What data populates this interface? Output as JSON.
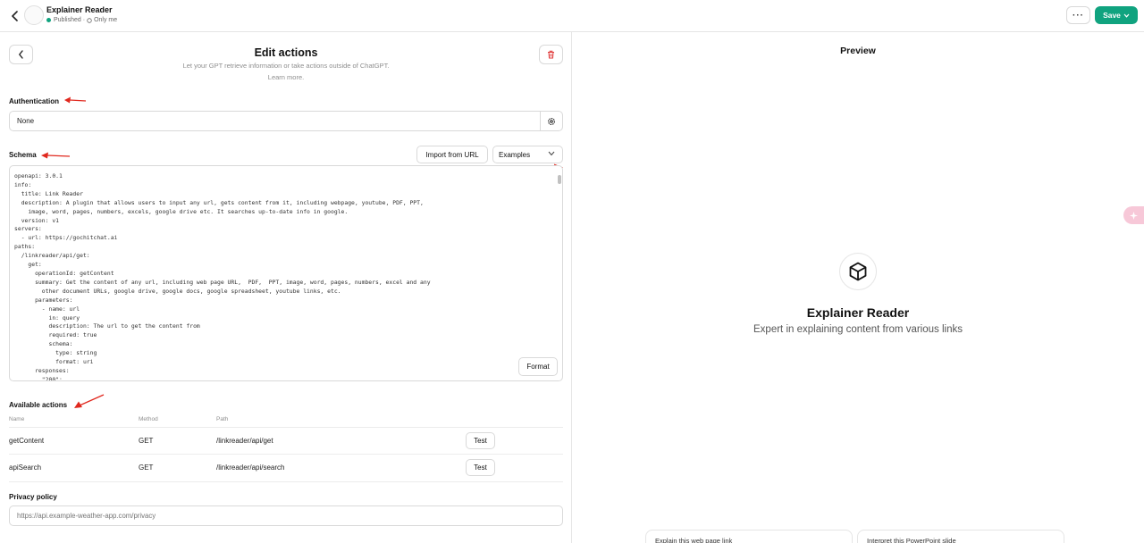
{
  "header": {
    "gpt_name": "Explainer Reader",
    "status": "Published",
    "visibility": "Only me",
    "more_label": "···",
    "save_label": "Save"
  },
  "edit": {
    "title": "Edit actions",
    "subtitle": "Let your GPT retrieve information or take actions outside of ChatGPT.",
    "learn_more": "Learn more."
  },
  "authentication": {
    "label": "Authentication",
    "value": "None"
  },
  "schema": {
    "label": "Schema",
    "import_label": "Import from URL",
    "examples_label": "Examples",
    "format_label": "Format",
    "code": "openapi: 3.0.1\ninfo:\n  title: Link Reader\n  description: A plugin that allows users to input any url, gets content from it, including webpage, youtube, PDF, PPT,\n    image, word, pages, numbers, excels, google drive etc. It searches up-to-date info in google.\n  version: v1\nservers:\n  - url: https://gochitchat.ai\npaths:\n  /linkreader/api/get:\n    get:\n      operationId: getContent\n      summary: Get the content of any url, including web page URL,  PDF,  PPT, image, word, pages, numbers, excel and any\n        other document URLs, google drive, google docs, google spreadsheet, youtube links, etc.\n      parameters:\n        - name: url\n          in: query\n          description: The url to get the content from\n          required: true\n          schema:\n            type: string\n            format: uri\n      responses:\n        \"200\":"
  },
  "actions": {
    "label": "Available actions",
    "col_name": "Name",
    "col_method": "Method",
    "col_path": "Path",
    "rows": [
      {
        "name": "getContent",
        "method": "GET",
        "path": "/linkreader/api/get",
        "test": "Test"
      },
      {
        "name": "apiSearch",
        "method": "GET",
        "path": "/linkreader/api/search",
        "test": "Test"
      }
    ]
  },
  "privacy": {
    "label": "Privacy policy",
    "placeholder": "https://api.example-weather-app.com/privacy"
  },
  "preview": {
    "title": "Preview",
    "name": "Explainer Reader",
    "description": "Expert in explaining content from various links",
    "starters": [
      "Explain this web page link",
      "Interpret this PowerPoint slide"
    ]
  },
  "colors": {
    "accent": "#10a37f",
    "arrow": "#e0281e",
    "danger": "#e03b3b"
  }
}
